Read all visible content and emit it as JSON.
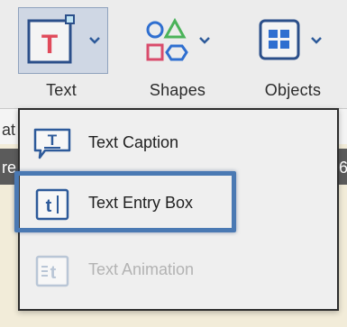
{
  "toolbar": {
    "tools": [
      {
        "label": "Text",
        "icon": "text-tool-icon",
        "selected": true
      },
      {
        "label": "Shapes",
        "icon": "shapes-tool-icon",
        "selected": false
      },
      {
        "label": "Objects",
        "icon": "objects-tool-icon",
        "selected": false
      }
    ]
  },
  "background": {
    "fragment_1": "at",
    "fragment_2": "re",
    "fragment_3": "6"
  },
  "menu": {
    "items": [
      {
        "label": "Text Caption",
        "icon": "text-caption-icon",
        "enabled": true
      },
      {
        "label": "Text Entry Box",
        "icon": "text-entry-box-icon",
        "enabled": true,
        "highlighted": true
      },
      {
        "label": "Text Animation",
        "icon": "text-animation-icon",
        "enabled": false
      }
    ]
  },
  "colors": {
    "accent": "#4a79b3",
    "text_icon_red": "#e04a5a",
    "shapes_green": "#4bb35a",
    "shapes_red": "#d94b6b",
    "shapes_blue": "#2f6fd0",
    "icon_blue": "#2d5a9a"
  }
}
